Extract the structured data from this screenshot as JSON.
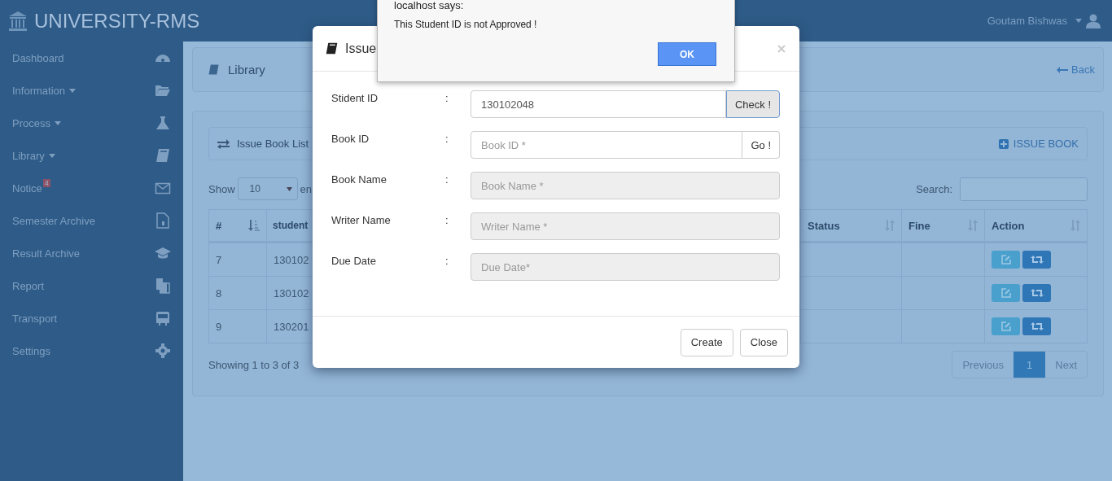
{
  "brand": {
    "title": "UNIVERSITY-RMS"
  },
  "user": {
    "name": "Goutam Bishwas"
  },
  "sidebar": {
    "items": [
      {
        "label": "Dashboard",
        "has_submenu": false
      },
      {
        "label": "Information",
        "has_submenu": true
      },
      {
        "label": "Process",
        "has_submenu": true
      },
      {
        "label": "Library",
        "has_submenu": true
      },
      {
        "label": "Notice",
        "has_submenu": false,
        "badge": "4"
      },
      {
        "label": "Semester Archive",
        "has_submenu": false
      },
      {
        "label": "Result Archive",
        "has_submenu": false
      },
      {
        "label": "Report",
        "has_submenu": false
      },
      {
        "label": "Transport",
        "has_submenu": false
      },
      {
        "label": "Settings",
        "has_submenu": false
      }
    ]
  },
  "page_header": {
    "title": "Library",
    "back_link": "Back"
  },
  "list_panel": {
    "title": "Issue Book List",
    "action": "ISSUE BOOK"
  },
  "table_controls": {
    "show_label": "Show",
    "page_size": "10",
    "entries_label": "en",
    "search_label": "Search:"
  },
  "table": {
    "columns": [
      {
        "label": "#",
        "sorted": true
      },
      {
        "label": "student",
        "sorted": false
      },
      {
        "label": "Status",
        "sorted": false
      },
      {
        "label": "Fine",
        "sorted": false
      },
      {
        "label": "Action",
        "sorted": false
      }
    ],
    "rows": [
      {
        "number": "7",
        "student": "130102"
      },
      {
        "number": "8",
        "student": "130102"
      },
      {
        "number": "9",
        "student": "130201"
      }
    ]
  },
  "table_footer": {
    "info": "Showing 1 to 3 of 3",
    "pages": [
      {
        "label": "Previous",
        "selected": false
      },
      {
        "label": "1",
        "selected": true
      },
      {
        "label": "Next",
        "selected": false
      }
    ]
  },
  "modal": {
    "title": "Issue",
    "fields": [
      {
        "label": "Stident ID",
        "value": "130102048",
        "button": "Check !",
        "disabled": false,
        "button_pressed": true
      },
      {
        "label": "Book ID",
        "placeholder": "Book ID *",
        "button": "Go !",
        "disabled": false,
        "button_pressed": false
      },
      {
        "label": "Book Name",
        "placeholder": "Book Name *",
        "disabled": true
      },
      {
        "label": "Writer Name",
        "placeholder": "Writer Name *",
        "disabled": true
      },
      {
        "label": "Due Date",
        "placeholder": "Due Date*",
        "disabled": true
      }
    ],
    "separator": ":",
    "buttons": [
      "Create",
      "Close"
    ]
  },
  "alert": {
    "title": "localhost says:",
    "message": "This Student ID is not Approved !",
    "button": "OK"
  }
}
